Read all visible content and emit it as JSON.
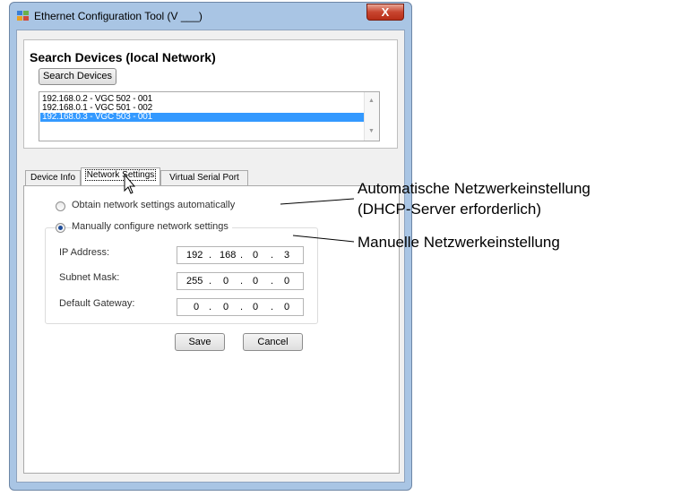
{
  "window": {
    "title": "Ethernet Configuration Tool (V ___)",
    "close_glyph": "X"
  },
  "search": {
    "heading": "Search Devices (local Network)",
    "button_label": "Search Devices",
    "devices": [
      {
        "label": "192.168.0.2 - VGC 502 - 001",
        "selected": false
      },
      {
        "label": "192.168.0.1 - VGC 501 - 002",
        "selected": false
      },
      {
        "label": "192.168.0.3 - VGC 503 - 001",
        "selected": true
      }
    ]
  },
  "tabs": [
    {
      "label": "Device Info",
      "active": false
    },
    {
      "label": "Network Settings",
      "active": true
    },
    {
      "label": "Virtual Serial Port",
      "active": false
    }
  ],
  "network": {
    "auto_label": "Obtain network settings automatically",
    "auto_selected": false,
    "manual_label": "Manually configure network settings",
    "manual_selected": true,
    "fields": [
      {
        "label": "IP Address:",
        "octets": [
          "192",
          "168",
          "0",
          "3"
        ]
      },
      {
        "label": "Subnet Mask:",
        "octets": [
          "255",
          "0",
          "0",
          "0"
        ]
      },
      {
        "label": "Default Gateway:",
        "octets": [
          "0",
          "0",
          "0",
          "0"
        ]
      }
    ],
    "save_label": "Save",
    "cancel_label": "Cancel"
  },
  "annotations": {
    "auto_line1": "Automatische Netzwerkeinstellung",
    "auto_line2": "(DHCP-Server erforderlich)",
    "manual": "Manuelle Netzwerkeinstellung"
  },
  "colors": {
    "selection": "#3399ff",
    "window_frame": "#a9c5e4",
    "close_button": "#c8452f"
  }
}
